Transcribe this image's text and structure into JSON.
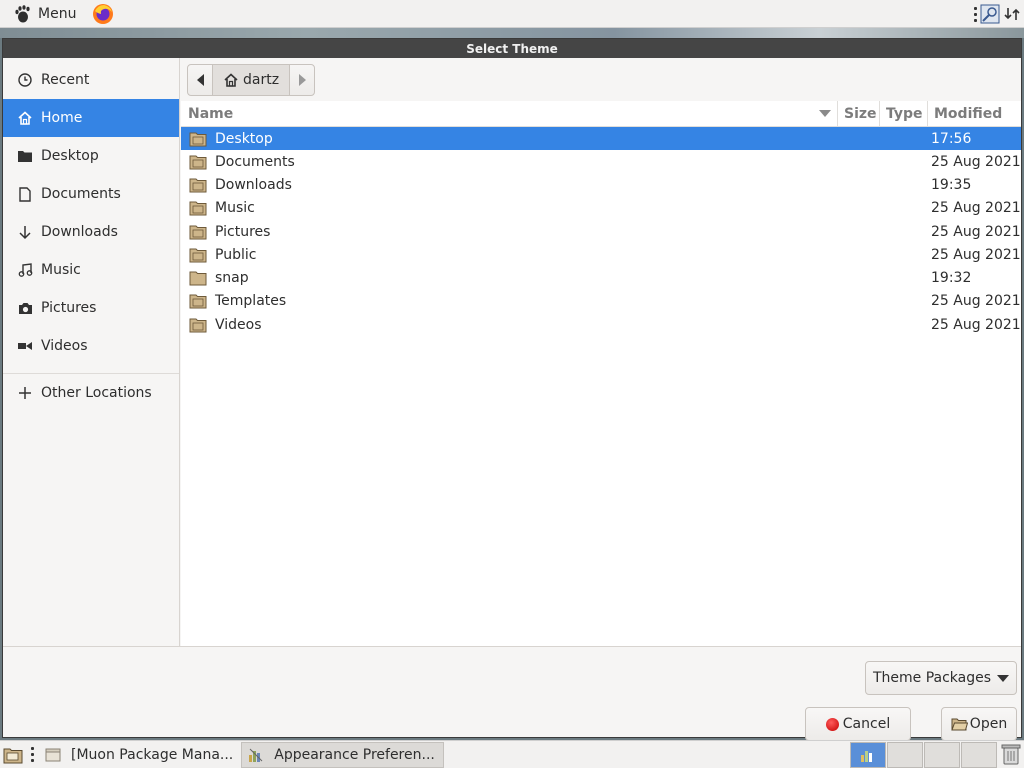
{
  "top_panel": {
    "menu_label": "Menu",
    "launchers": [
      "foot-icon",
      "firefox-icon"
    ],
    "tray_icons": [
      "vertical-dots-icon",
      "magnifier-icon",
      "network-icon"
    ]
  },
  "window": {
    "title": "Select Theme"
  },
  "sidebar": {
    "items": [
      {
        "label": "Recent",
        "icon": "clock-icon"
      },
      {
        "label": "Home",
        "icon": "home-icon",
        "active": true
      },
      {
        "label": "Desktop",
        "icon": "folder-icon"
      },
      {
        "label": "Documents",
        "icon": "document-icon"
      },
      {
        "label": "Downloads",
        "icon": "download-arrow-icon"
      },
      {
        "label": "Music",
        "icon": "music-note-icon"
      },
      {
        "label": "Pictures",
        "icon": "camera-icon"
      },
      {
        "label": "Videos",
        "icon": "video-icon"
      }
    ],
    "other_locations": {
      "label": "Other Locations",
      "icon": "plus-icon"
    }
  },
  "pathbar": {
    "current": "dartz"
  },
  "columns": {
    "name": "Name",
    "size": "Size",
    "type": "Type",
    "modified": "Modified"
  },
  "files": [
    {
      "name": "Desktop",
      "modified": "17:56",
      "selected": true
    },
    {
      "name": "Documents",
      "modified": "25 Aug 2021"
    },
    {
      "name": "Downloads",
      "modified": "19:35"
    },
    {
      "name": "Music",
      "modified": "25 Aug 2021"
    },
    {
      "name": "Pictures",
      "modified": "25 Aug 2021"
    },
    {
      "name": "Public",
      "modified": "25 Aug 2021"
    },
    {
      "name": "snap",
      "modified": "19:32"
    },
    {
      "name": "Templates",
      "modified": "25 Aug 2021"
    },
    {
      "name": "Videos",
      "modified": "25 Aug 2021"
    }
  ],
  "footer": {
    "filter": "Theme Packages",
    "cancel": "Cancel",
    "open": "Open"
  },
  "taskbar": {
    "tasks": [
      {
        "label": "[Muon Package Mana..."
      },
      {
        "label": "Appearance Preferen...",
        "active": true
      }
    ]
  },
  "colors": {
    "accent": "#3584e4",
    "titlebar": "#454545"
  }
}
